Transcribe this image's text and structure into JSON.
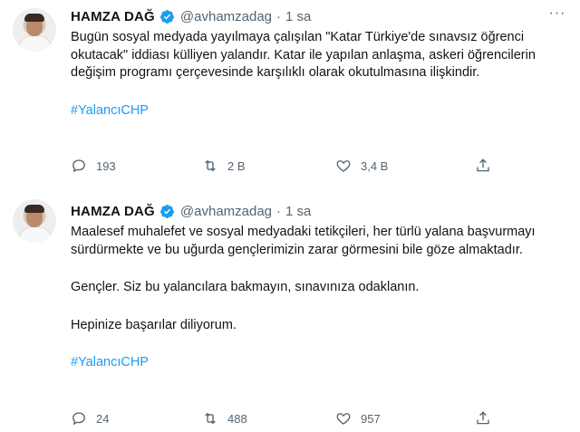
{
  "tweets": [
    {
      "author_name": "HAMZA DAĞ",
      "handle": "@avhamzadag",
      "dot": "·",
      "time": "1 sa",
      "more": "···",
      "paragraphs": [
        "Bugün sosyal medyada yayılmaya çalışılan \"Katar Türkiye'de sınavsız öğrenci okutacak\" iddiası külliyen yalandır. Katar ile yapılan anlaşma, askeri öğrencilerin değişim programı çerçevesinde karşılıklı olarak okutulmasına ilişkindir."
      ],
      "hashtag": "#YalancıCHP",
      "replies": "193",
      "retweets": "2 B",
      "likes": "3,4 B"
    },
    {
      "author_name": "HAMZA DAĞ",
      "handle": "@avhamzadag",
      "dot": "·",
      "time": "1 sa",
      "more": "···",
      "paragraphs": [
        "Maalesef muhalefet ve sosyal medyadaki tetikçileri, her türlü yalana başvurmayı sürdürmekte ve bu uğurda gençlerimizin zarar görmesini bile göze almaktadır.",
        "Gençler. Siz bu yalancılara bakmayın, sınavınıza odaklanın.",
        "Hepinize başarılar diliyorum."
      ],
      "hashtag": "#YalancıCHP",
      "replies": "24",
      "retweets": "488",
      "likes": "957"
    }
  ],
  "icons": {
    "verified": "verified-badge-icon",
    "reply": "reply-icon",
    "retweet": "retweet-icon",
    "like": "heart-icon",
    "share": "share-icon",
    "more": "more-icon"
  },
  "colors": {
    "link": "#1d9bf0",
    "muted": "#536471",
    "text": "#0f1419"
  }
}
